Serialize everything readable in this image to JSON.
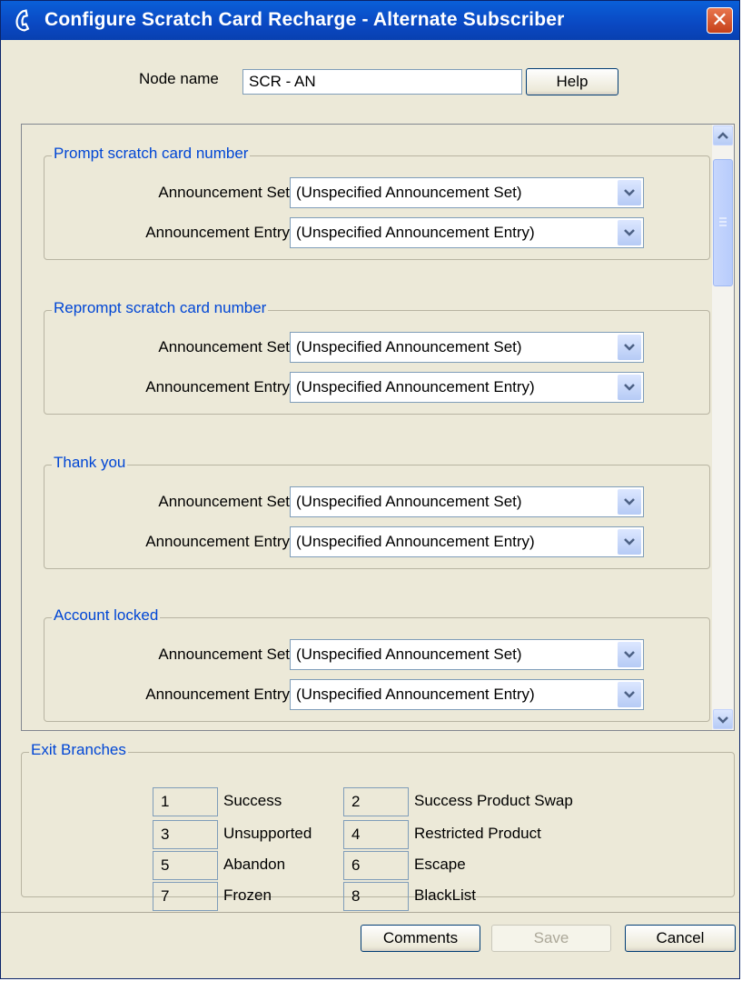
{
  "window": {
    "title": "Configure Scratch Card Recharge - Alternate Subscriber"
  },
  "node": {
    "label": "Node name",
    "value": "SCR - AN",
    "help_label": "Help"
  },
  "groups": [
    {
      "title": "Prompt scratch card number",
      "set_label": "Announcement Set",
      "set_value": "(Unspecified Announcement Set)",
      "entry_label": "Announcement Entry",
      "entry_value": "(Unspecified Announcement Entry)"
    },
    {
      "title": "Reprompt scratch card number",
      "set_label": "Announcement Set",
      "set_value": "(Unspecified Announcement Set)",
      "entry_label": "Announcement Entry",
      "entry_value": "(Unspecified Announcement Entry)"
    },
    {
      "title": "Thank you",
      "set_label": "Announcement Set",
      "set_value": "(Unspecified Announcement Set)",
      "entry_label": "Announcement Entry",
      "entry_value": "(Unspecified Announcement Entry)"
    },
    {
      "title": "Account locked",
      "set_label": "Announcement Set",
      "set_value": "(Unspecified Announcement Set)",
      "entry_label": "Announcement Entry",
      "entry_value": "(Unspecified Announcement Entry)"
    }
  ],
  "exit_branches": {
    "title": "Exit Branches",
    "items": [
      {
        "num": "1",
        "name": "Success"
      },
      {
        "num": "2",
        "name": "Success Product Swap"
      },
      {
        "num": "3",
        "name": "Unsupported"
      },
      {
        "num": "4",
        "name": "Restricted Product"
      },
      {
        "num": "5",
        "name": "Abandon"
      },
      {
        "num": "6",
        "name": "Escape"
      },
      {
        "num": "7",
        "name": "Frozen"
      },
      {
        "num": "8",
        "name": "BlackList"
      }
    ]
  },
  "buttons": {
    "comments": "Comments",
    "save": "Save",
    "cancel": "Cancel"
  },
  "icons": {
    "app": "phone-handset-icon",
    "close": "close-icon",
    "dropdown": "chevron-down-icon"
  },
  "colors": {
    "titlebar": "#0a48c2",
    "legend_text": "#0046d5",
    "close": "#c6401a"
  }
}
